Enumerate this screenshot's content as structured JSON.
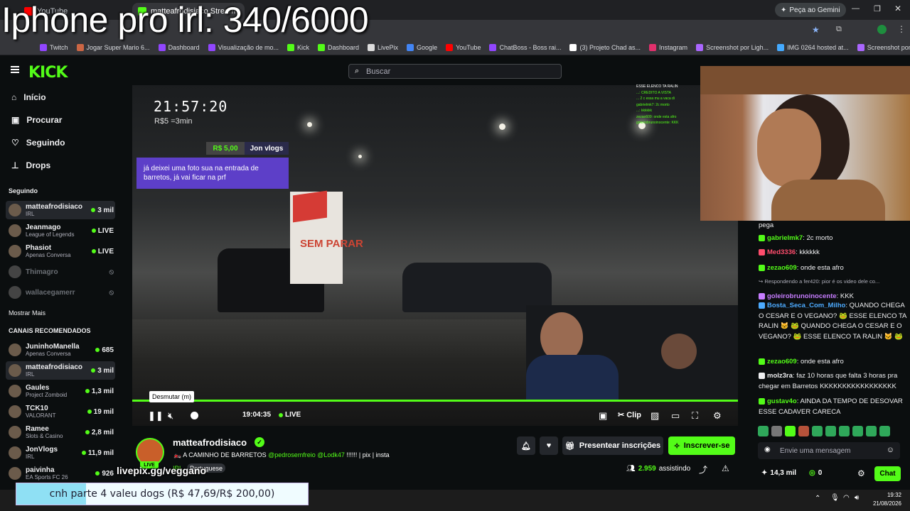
{
  "overlay_title": "Iphone pro irl: 340/6000",
  "browser": {
    "tabs": [
      {
        "label": "YouTube",
        "color": "#ff0000"
      },
      {
        "label": "matteafrodisiaco Stream - ",
        "color": "#53fc18"
      }
    ],
    "gemini_label": "Peça ao Gemini",
    "bookmarks": [
      {
        "label": "Twitch",
        "color": "#9146ff"
      },
      {
        "label": "Jogar Super Mario 6...",
        "color": "#c64"
      },
      {
        "label": "Dashboard",
        "color": "#9146ff"
      },
      {
        "label": "Visualização de mo...",
        "color": "#9146ff"
      },
      {
        "label": "Kick",
        "color": "#53fc18"
      },
      {
        "label": "Dashboard",
        "color": "#53fc18"
      },
      {
        "label": "LivePix",
        "color": "#ddd"
      },
      {
        "label": "Google",
        "color": "#4285f4"
      },
      {
        "label": "YouTube",
        "color": "#ff0000"
      },
      {
        "label": "ChatBoss - Boss rai...",
        "color": "#9146ff"
      },
      {
        "label": "(3) Projeto Chad as...",
        "color": "#fff"
      },
      {
        "label": "Instagram",
        "color": "#e1306c"
      },
      {
        "label": "Screenshot por Ligh...",
        "color": "#a6f"
      },
      {
        "label": "IMG 0264 hosted at...",
        "color": "#4af"
      },
      {
        "label": "Screenshot por Ligh...",
        "color": "#a6f"
      }
    ]
  },
  "header": {
    "logo": "KICK",
    "search_placeholder": "Buscar"
  },
  "sidebar": {
    "nav": [
      {
        "label": "Início",
        "icon": "home-icon"
      },
      {
        "label": "Procurar",
        "icon": "browse-icon"
      },
      {
        "label": "Seguindo",
        "icon": "heart-icon"
      },
      {
        "label": "Drops",
        "icon": "drops-icon"
      }
    ],
    "following_title": "Seguindo",
    "following": [
      {
        "name": "matteafrodisiaco",
        "sub": "IRL",
        "stat": "3 mil",
        "live": true,
        "selected": true
      },
      {
        "name": "Jeanmago",
        "sub": "League of Legends",
        "stat": "LIVE",
        "live": true
      },
      {
        "name": "Phasiot",
        "sub": "Apenas Conversa",
        "stat": "LIVE",
        "live": true
      },
      {
        "name": "Thimagro",
        "sub": "",
        "stat": "",
        "live": false
      },
      {
        "name": "wallacegamerr",
        "sub": "",
        "stat": "",
        "live": false
      }
    ],
    "show_more": "Mostrar Mais",
    "recommended_title": "CANAIS RECOMENDADOS",
    "recommended": [
      {
        "name": "JuninhoManella",
        "sub": "Apenas Conversa",
        "stat": "685"
      },
      {
        "name": "matteafrodisiaco",
        "sub": "IRL",
        "stat": "3 mil",
        "selected": true
      },
      {
        "name": "Gaules",
        "sub": "Project Zomboid",
        "stat": "1,3 mil"
      },
      {
        "name": "TCK10",
        "sub": "VALORANT",
        "stat": "19 mil"
      },
      {
        "name": "Ramee",
        "sub": "Slots & Casino",
        "stat": "2,8 mil"
      },
      {
        "name": "JonVlogs",
        "sub": "IRL",
        "stat": "11,9 mil"
      },
      {
        "name": "paivinha",
        "sub": "EA Sports FC 26",
        "stat": "926"
      }
    ]
  },
  "video": {
    "clock": "21:57:20",
    "rate": "R$5 =3min",
    "donation_amount": "R$ 5,00",
    "donation_name": "Jon vlogs",
    "donation_message": "já deixei uma foto sua na entrada de barretos, já vai ficar na prf",
    "sign_text": "SEM PARAR",
    "mini_chat": [
      "ESSE ELENCO TA RALIN",
      "...: CREDITO A VISTA",
      "... 2 c essa mu a vaca di",
      "gabrielmk7: 2c morto",
      "...: kkkkkk",
      "zezao609: onde esta afro",
      "goleirobrunoinocente: KKK"
    ],
    "tooltip": "Desmutar (m)",
    "time": "19:04:35",
    "live_label": "LIVE",
    "clip_label": "Clip"
  },
  "stream_info": {
    "name": "matteafrodisiaco",
    "live_badge": "LIVE",
    "title_prefix": "🏍️ A CAMINHO DE BARRETOS ",
    "title_mentions": "@pedrosemfreio @Lodk47",
    "title_suffix": " !!!!!! | pix | insta",
    "category": "IRL",
    "language": "Portuguese",
    "gift_label": "Presentear inscrições",
    "subscribe_label": "Inscrever-se",
    "viewers_count": "2.959",
    "viewers_label": "assistindo"
  },
  "chat": {
    "messages": [
      {
        "user": "",
        "color": "#efeff1",
        "text": "pega"
      },
      {
        "user": "gabrielmk7",
        "color": "#53fc18",
        "text": "2c morto"
      },
      {
        "user": "Med3336",
        "color": "#ff4d6d",
        "text": "kkkkkk"
      },
      {
        "user": "zezao609",
        "color": "#53fc18",
        "text": "onde esta afro"
      },
      {
        "user": "goleirobrunoinocente",
        "color": "#c77dff",
        "text": "KKK"
      },
      {
        "user": "Bosta_Seca_Com_Milho",
        "color": "#4dabff",
        "text": "QUANDO CHEGA O CESAR E O VEGANO? 🐸 ESSE ELENCO TA RALIN 🐱 🐸 QUANDO CHEGA O CESAR E O VEGANO? 🐸 ESSE ELENCO TA RALIN 🐱 🐸"
      },
      {
        "user": "zezao609",
        "color": "#53fc18",
        "text": "onde esta afro"
      },
      {
        "user": "molz3ra",
        "color": "#efeff1",
        "text": "faz 10 horas que falta 3 horas pra chegar em Barretos KKKKKKKKKKKKKKKKK"
      },
      {
        "user": "gustav4o",
        "color": "#53fc18",
        "text": "AINDA DA TEMPO DE DESOVAR ESSE CADAVER CARECA"
      }
    ],
    "reply_note": "Respondendo a fer420: pior é os video dele co...",
    "input_placeholder": "Envie uma mensagem",
    "points": "14,3 mil",
    "kicks": "0",
    "chat_button": "Chat"
  },
  "overlays": {
    "livepix": "livepix.gg/veggano",
    "goal_text": "cnh parte 4 valeu dogs (R$ 47,69/R$ 200,00)",
    "goal_current": 47.69,
    "goal_target": 200
  },
  "taskbar": {
    "time": "19:32",
    "date": "21/08/2026"
  }
}
